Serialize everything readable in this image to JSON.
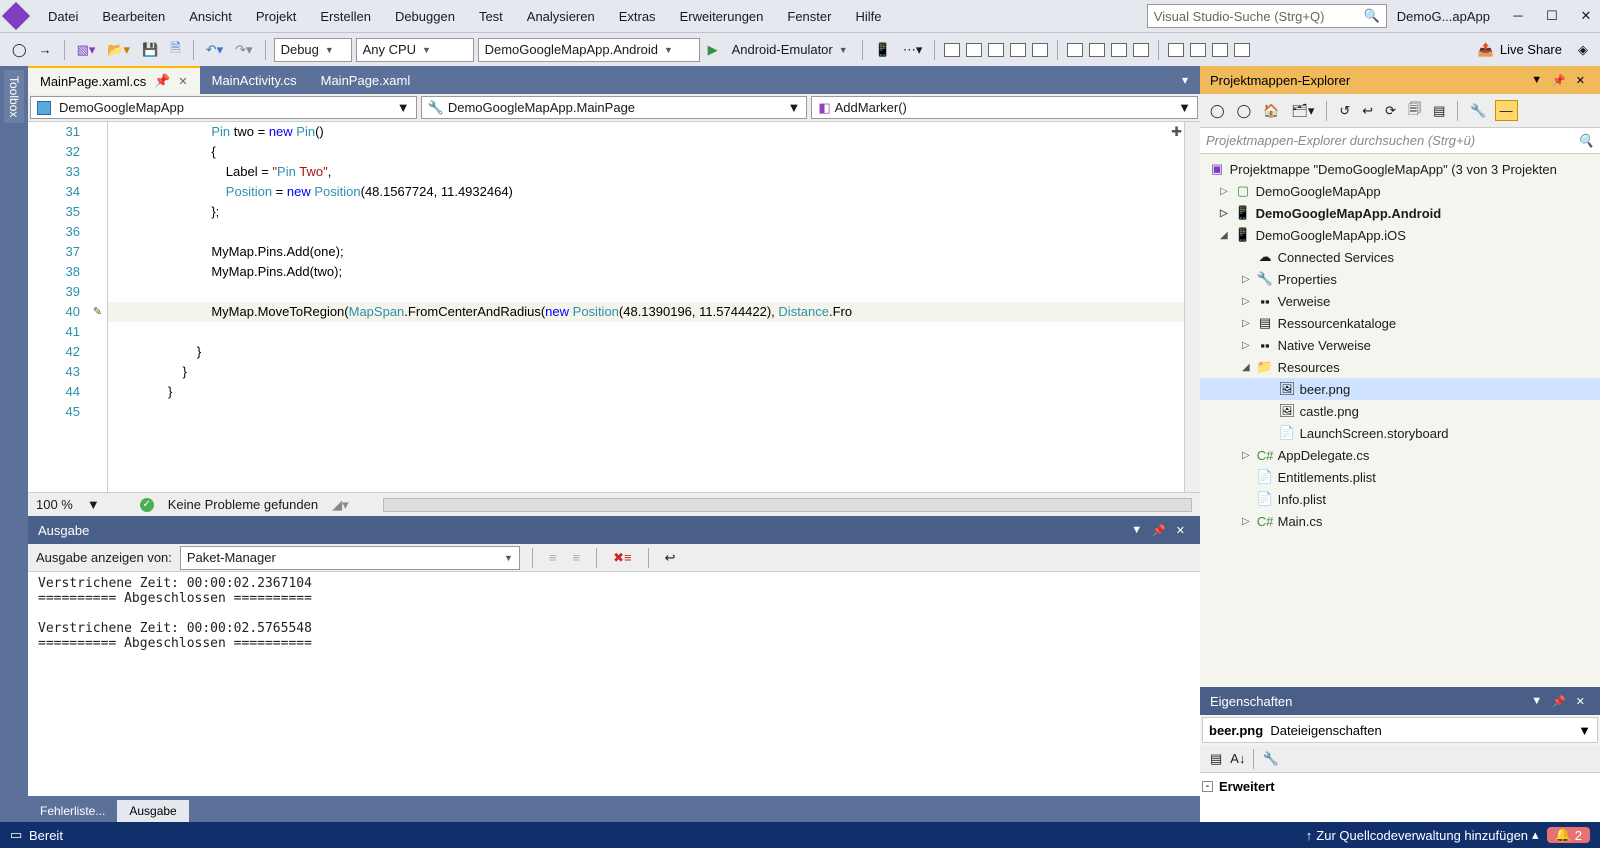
{
  "title": {
    "solution_name": "DemoG...apApp"
  },
  "menu": [
    "Datei",
    "Bearbeiten",
    "Ansicht",
    "Projekt",
    "Erstellen",
    "Debuggen",
    "Test",
    "Analysieren",
    "Extras",
    "Erweiterungen",
    "Fenster",
    "Hilfe"
  ],
  "search": {
    "placeholder": "Visual Studio-Suche (Strg+Q)"
  },
  "toolbar": {
    "config": "Debug",
    "platform": "Any CPU",
    "startup": "DemoGoogleMapApp.Android",
    "device": "Android-Emulator",
    "liveshare": "Live Share"
  },
  "sidebar": {
    "toolbox": "Toolbox"
  },
  "tabs": [
    {
      "label": "MainPage.xaml.cs",
      "active": true,
      "pinned": true
    },
    {
      "label": "MainActivity.cs",
      "active": false
    },
    {
      "label": "MainPage.xaml",
      "active": false
    }
  ],
  "navbar": {
    "left": "DemoGoogleMapApp",
    "mid": "DemoGoogleMapApp.MainPage",
    "right": "AddMarker()"
  },
  "editor": {
    "lines": [
      {
        "n": 31,
        "t": "            Pin two = new Pin()"
      },
      {
        "n": 32,
        "t": "            {"
      },
      {
        "n": 33,
        "t": "                Label = \"Pin Two\","
      },
      {
        "n": 34,
        "t": "                Position = new Position(48.1567724, 11.4932464)"
      },
      {
        "n": 35,
        "t": "            };"
      },
      {
        "n": 36,
        "t": ""
      },
      {
        "n": 37,
        "t": "            MyMap.Pins.Add(one);"
      },
      {
        "n": 38,
        "t": "            MyMap.Pins.Add(two);"
      },
      {
        "n": 39,
        "t": ""
      },
      {
        "n": 40,
        "t": "            MyMap.MoveToRegion(MapSpan.FromCenterAndRadius(new Position(48.1390196, 11.5744422), Distance.Fro"
      },
      {
        "n": 41,
        "t": ""
      },
      {
        "n": 42,
        "t": "        }"
      },
      {
        "n": 43,
        "t": "    }"
      },
      {
        "n": 44,
        "t": "}"
      },
      {
        "n": 45,
        "t": ""
      }
    ],
    "pencil_at": 40,
    "highlight_at": 40,
    "zoom": "100 %",
    "status": "Keine Probleme gefunden"
  },
  "output": {
    "title": "Ausgabe",
    "source_label": "Ausgabe anzeigen von:",
    "source": "Paket-Manager",
    "text": "Verstrichene Zeit: 00:00:02.2367104\n========== Abgeschlossen ==========\n\nVerstrichene Zeit: 00:00:02.5765548\n========== Abgeschlossen ==========\n"
  },
  "bottom_tabs": [
    {
      "label": "Fehlerliste...",
      "active": false
    },
    {
      "label": "Ausgabe",
      "active": true
    }
  ],
  "explorer": {
    "title": "Projektmappen-Explorer",
    "search_placeholder": "Projektmappen-Explorer durchsuchen (Strg+ü)",
    "solution": "Projektmappe \"DemoGoogleMapApp\" (3 von 3 Projekten",
    "nodes": {
      "p1": "DemoGoogleMapApp",
      "p2": "DemoGoogleMapApp.Android",
      "p3": "DemoGoogleMapApp.iOS",
      "connected": "Connected Services",
      "props": "Properties",
      "refs": "Verweise",
      "rescat": "Ressourcenkataloge",
      "native": "Native Verweise",
      "resources": "Resources",
      "beer": "beer.png",
      "castle": "castle.png",
      "launch": "LaunchScreen.storyboard",
      "appdel": "AppDelegate.cs",
      "entitle": "Entitlements.plist",
      "info": "Info.plist",
      "main": "Main.cs"
    }
  },
  "props": {
    "title": "Eigenschaften",
    "subject_name": "beer.png",
    "subject_type": "Dateieigenschaften",
    "group": "Erweitert"
  },
  "statusbar": {
    "ready": "Bereit",
    "vcs": "Zur Quellcodeverwaltung hinzufügen",
    "notif": "2"
  }
}
